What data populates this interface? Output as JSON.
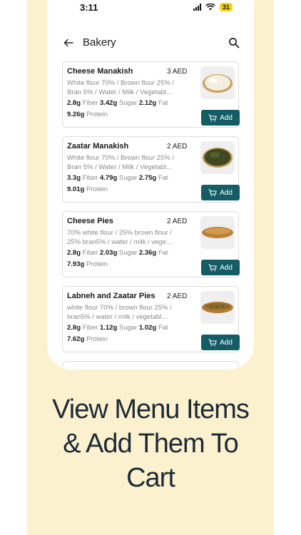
{
  "status_bar": {
    "time": "3:11",
    "battery": "31"
  },
  "header": {
    "title": "Bakery"
  },
  "items": [
    {
      "name": "Cheese Manakish",
      "price": "3 AED",
      "ingredients_1": "White flour 70% / Brown flour 25% /",
      "ingredients_2": "Bran 5% / Water / Milk / Vegetabl...",
      "fiber": "2.8g",
      "fiber_label": "Fiber",
      "sugar": "3.42g",
      "sugar_label": "Sugar",
      "fat": "2.12g",
      "fat_label": "Fat",
      "protein": "9.26g",
      "protein_label": "Protein",
      "add_label": "Add",
      "image": "cheese-manakish-image"
    },
    {
      "name": "Zaatar Manakish",
      "price": "2 AED",
      "ingredients_1": "White flour 70% / Brown flour 25% /",
      "ingredients_2": "Bran 5% / Water / Milk / Vegetabl...",
      "fiber": "3.3g",
      "fiber_label": "Fiber",
      "sugar": "4.79g",
      "sugar_label": "Sugar",
      "fat": "2.75g",
      "fat_label": "Fat",
      "protein": "9.01g",
      "protein_label": "Protein",
      "add_label": "Add",
      "image": "zaatar-manakish-image"
    },
    {
      "name": "Cheese Pies",
      "price": "2 AED",
      "ingredients_1": "70% white flour / 25% brown flour /",
      "ingredients_2": "25% bran5% / water / milk / vege...",
      "fiber": "2.8g",
      "fiber_label": "Fiber",
      "sugar": "2.03g",
      "sugar_label": "Sugar",
      "fat": "2.36g",
      "fat_label": "Fat",
      "protein": "7.93g",
      "protein_label": "Protein",
      "add_label": "Add",
      "image": "cheese-pies-image"
    },
    {
      "name": "Labneh and Zaatar Pies",
      "price": "2 AED",
      "ingredients_1": "white flour 70% / brown flour 25% /",
      "ingredients_2": "bran5% / water / milk / vegetabl...",
      "fiber": "2.8g",
      "fiber_label": "Fiber",
      "sugar": "1.12g",
      "sugar_label": "Sugar",
      "fat": "1.02g",
      "fat_label": "Fat",
      "protein": "7.62g",
      "protein_label": "Protein",
      "add_label": "Add",
      "image": "labneh-zaatar-pies-image"
    }
  ],
  "tagline": {
    "line1": "View Menu Items",
    "line2": "& Add Them To",
    "line3": "Cart"
  },
  "colors": {
    "background": "#fbf1cf",
    "accent": "#145c66",
    "text": "#1d2a36"
  }
}
